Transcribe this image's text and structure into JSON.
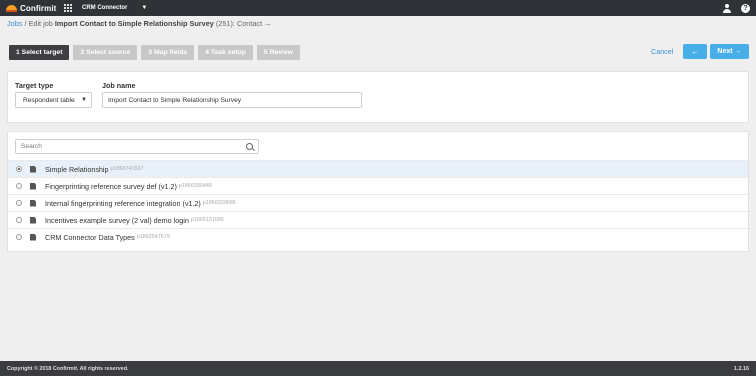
{
  "topbar": {
    "logo_text": "Confirmit",
    "app_name": "CRM Connector",
    "icons": [
      "grid-icon",
      "user-icon",
      "help-icon"
    ],
    "help_glyph": "?"
  },
  "breadcrumb": {
    "root": "Jobs",
    "sep": " / ",
    "prefix": "Edit job ",
    "job_title": "Import Contact to Simple Relationship Survey",
    "job_id": " (251): Contact ",
    "arrow": "→"
  },
  "steps": [
    {
      "label": "1 Select target",
      "active": true
    },
    {
      "label": "2 Select source",
      "active": false
    },
    {
      "label": "3 Map fields",
      "active": false
    },
    {
      "label": "4 Task setup",
      "active": false
    },
    {
      "label": "5 Review",
      "active": false
    }
  ],
  "actions": {
    "cancel": "Cancel",
    "back": "←",
    "next": "Next",
    "next_arrow": "→"
  },
  "form": {
    "target_type_label": "Target type",
    "target_type_value": "Respondent table",
    "job_name_label": "Job name",
    "job_name_value": "Import Contact to Simple Relationship Survey"
  },
  "list": {
    "search_placeholder": "Search",
    "items": [
      {
        "title": "Simple Relationship",
        "id": "p1866741667",
        "selected": true
      },
      {
        "title": "Fingerprinting reference survey def (v1.2)",
        "id": "p1866330448",
        "selected": false
      },
      {
        "title": "Internal fingerprinting reference integration (v1.2)",
        "id": "p1866329686",
        "selected": false
      },
      {
        "title": "Incentives example survey (2 val) demo login",
        "id": "p1865151685",
        "selected": false
      },
      {
        "title": "CRM Connector Data Types",
        "id": "p1862547679",
        "selected": false
      }
    ]
  },
  "footer": {
    "copyright": "Copyright © 2018 Confirmit. All rights reserved.",
    "version": "1.2.16"
  },
  "colors": {
    "accent": "#47aee8",
    "topbar": "#2f3236",
    "active_step": "#3d3f42",
    "inactive_step": "#c8c8c8"
  }
}
